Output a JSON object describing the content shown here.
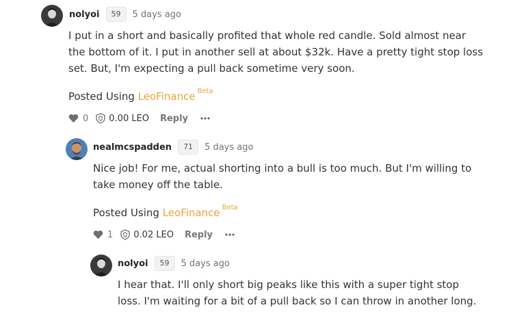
{
  "comments": [
    {
      "author": "nolyoi",
      "reputation": "59",
      "time": "5 days ago",
      "body_lines": [
        "I put in a short and basically profited that whole red candle. Sold almost near",
        "the bottom of it. I put in another sell at about $32k. Have a pretty tight stop loss",
        "set. But, I'm expecting a pull back sometime very soon."
      ],
      "posted_prefix": "Posted Using",
      "posted_link": "LeoFinance",
      "posted_badge": "Beta",
      "votes": "0",
      "payout": "0.00",
      "payout_unit": "LEO",
      "reply_label": "Reply"
    },
    {
      "author": "nealmcspadden",
      "reputation": "71",
      "time": "5 days ago",
      "body_lines": [
        "Nice job! For me, actual shorting into a bull is too much. But I'm willing to",
        "take money off the table."
      ],
      "posted_prefix": "Posted Using",
      "posted_link": "LeoFinance",
      "posted_badge": "Beta",
      "votes": "1",
      "payout": "0.02",
      "payout_unit": "LEO",
      "reply_label": "Reply"
    },
    {
      "author": "nolyoi",
      "reputation": "59",
      "time": "5 days ago",
      "body_lines": [
        "I hear that. I'll only short big peaks like this with a super tight stop",
        "loss. I'm waiting for a bit of a pull back so I can throw in another long."
      ]
    }
  ],
  "colors": {
    "link": "#e8a43a",
    "muted": "#6c757d"
  }
}
